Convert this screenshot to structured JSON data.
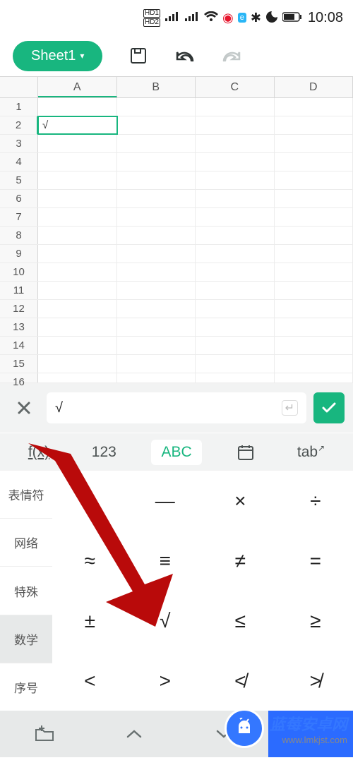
{
  "status": {
    "hd1": "HD1",
    "hd2": "HD2",
    "time": "10:08"
  },
  "toolbar": {
    "sheet_label": "Sheet1"
  },
  "grid": {
    "columns": [
      "A",
      "B",
      "C",
      "D"
    ],
    "rows": [
      "1",
      "2",
      "3",
      "4",
      "5",
      "6",
      "7",
      "8",
      "9",
      "10",
      "11",
      "12",
      "13",
      "14",
      "15",
      "16"
    ],
    "selected_cell_value": "√"
  },
  "formula": {
    "value": "√"
  },
  "modes": {
    "fx": "f(x)",
    "num": "123",
    "abc": "ABC",
    "tab": "tab"
  },
  "kbd_side": [
    "表情符",
    "网络",
    "特殊",
    "数学",
    "序号"
  ],
  "kbd_keys": [
    [
      "+",
      "—",
      "×",
      "÷"
    ],
    [
      "≈",
      "≡",
      "≠",
      "="
    ],
    [
      "±",
      "√",
      "≤",
      "≥"
    ],
    [
      "<",
      ">",
      "≮",
      "≯"
    ]
  ],
  "watermark": {
    "title": "蓝莓安卓网",
    "url": "www.lmkjst.com"
  }
}
